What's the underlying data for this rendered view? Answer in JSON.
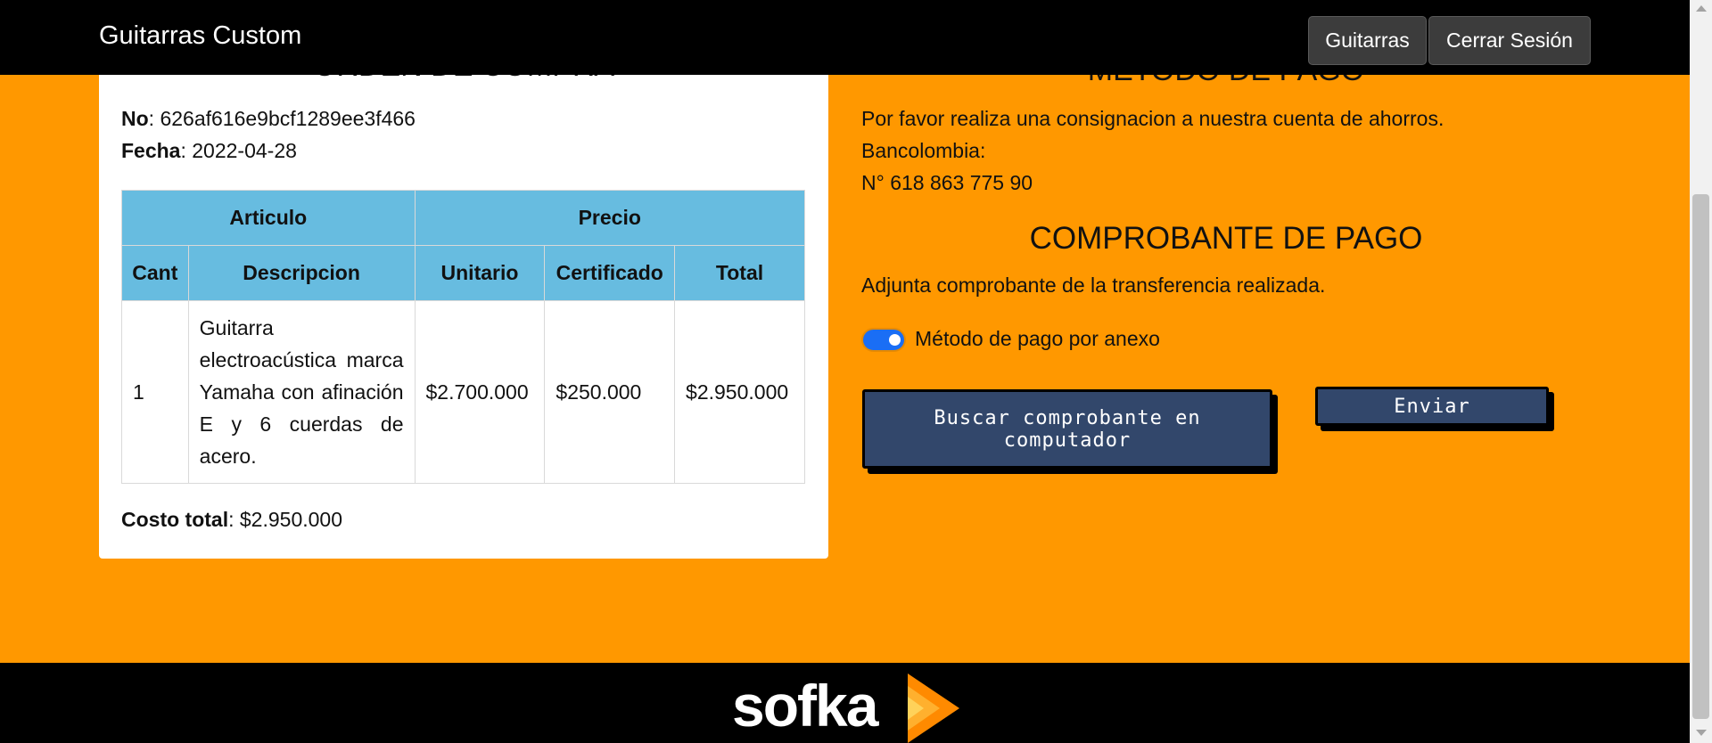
{
  "navbar": {
    "brand": "Guitarras Custom",
    "guitarras_label": "Guitarras",
    "logout_label": "Cerrar Sesión"
  },
  "order": {
    "title": "ORDEN DE COMPRA",
    "no_label": "No",
    "no_value": ": 626af616e9bcf1289ee3f466",
    "fecha_label": "Fecha",
    "fecha_value": ": 2022-04-28",
    "table": {
      "group_headers": [
        "Articulo",
        "Precio"
      ],
      "columns": [
        "Cant",
        "Descripcion",
        "Unitario",
        "Certificado",
        "Total"
      ],
      "rows": [
        {
          "cant": "1",
          "descripcion": "Guitarra electroacústica marca Yamaha con afinación E y 6 cuerdas de acero.",
          "unitario": "$2.700.000",
          "certificado": "$250.000",
          "total": "$2.950.000"
        }
      ]
    },
    "costo_label": "Costo total",
    "costo_value": ": $2.950.000"
  },
  "payment": {
    "title": "METODO DE PAGO",
    "line1": "Por favor realiza una consignacion a nuestra cuenta de ahorros.",
    "line2": "Bancolombia:",
    "line3": "N° 618 863 775 90",
    "proof_title": "COMPROBANTE DE PAGO",
    "proof_text": "Adjunta comprobante de la transferencia realizada.",
    "toggle_label": "Método de pago por anexo",
    "toggle_on": true,
    "buscar_label": "Buscar comprobante en computador",
    "enviar_label": "Enviar"
  },
  "footer": {
    "logo_text": "sofka"
  },
  "colors": {
    "page_bg": "#ff9800",
    "header_bg": "#000000",
    "table_header": "#67bce0",
    "action_button": "#32476b",
    "toggle": "#1a6ef5"
  }
}
